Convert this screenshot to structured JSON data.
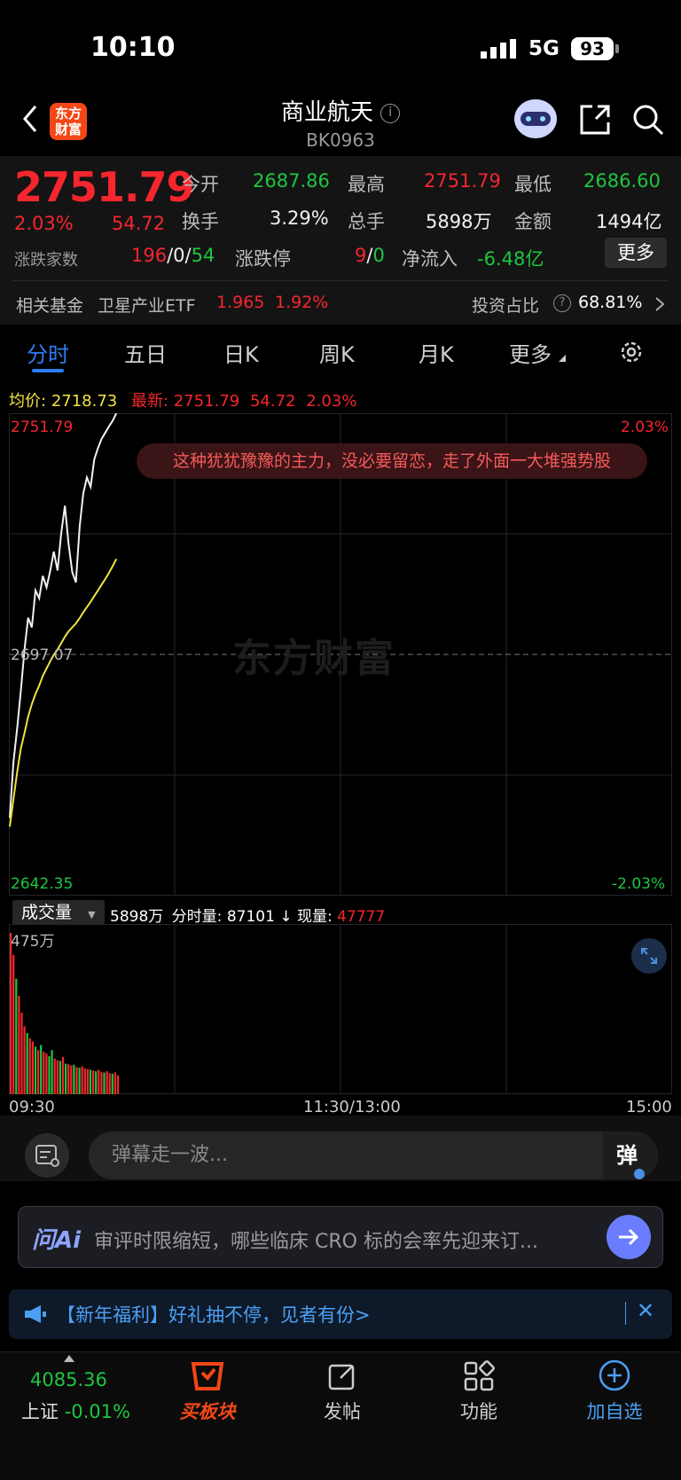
{
  "status_bar": {
    "time": "10:10",
    "network": "5G",
    "battery": "93"
  },
  "header": {
    "title": "商业航天",
    "code": "BK0963",
    "logo_text": "东方财富"
  },
  "quote": {
    "price": "2751.79",
    "change_pct": "2.03%",
    "change": "54.72",
    "open_label": "今开",
    "open": "2687.86",
    "high_label": "最高",
    "high": "2751.79",
    "low_label": "最低",
    "low": "2686.60",
    "turnover_label": "换手",
    "turnover": "3.29%",
    "volume_label": "总手",
    "volume": "5898万",
    "amount_label": "金额",
    "amount": "1494亿",
    "breadth_label": "涨跌家数",
    "breadth_up": "196",
    "breadth_flat": "0",
    "breadth_down": "54",
    "limit_label": "涨跌停",
    "limit_up": "9",
    "limit_down": "0",
    "netflow_label": "净流入",
    "netflow": "-6.48亿",
    "more_label": "更多",
    "fund_label": "相关基金",
    "fund_name": "卫星产业ETF",
    "fund_price": "1.965",
    "fund_pct": "1.92%",
    "ratio_label": "投资占比",
    "ratio": "68.81%"
  },
  "tabs": [
    "分时",
    "五日",
    "日K",
    "周K",
    "月K",
    "更多"
  ],
  "chart_info": {
    "avg_label": "均价:",
    "avg": "2718.73",
    "latest_label": "最新:",
    "latest": "2751.79",
    "latest_change": "54.72",
    "latest_pct": "2.03%",
    "top_price": "2751.79",
    "top_pct": "2.03%",
    "mid_price": "2697.07",
    "bottom_price": "2642.35",
    "bottom_pct": "-2.03%",
    "danmu": "这种犹犹豫豫的主力，没必要留恋，走了外面一大堆强势股",
    "watermark": "东方财富"
  },
  "volume_info": {
    "selector": "成交量",
    "total": "5898万",
    "minute_label": "分时量:",
    "minute_val": "87101",
    "now_label": "现量:",
    "now_val": "47777",
    "max": "475万"
  },
  "time_axis": {
    "start": "09:30",
    "mid": "11:30/13:00",
    "end": "15:00"
  },
  "chart_data": {
    "type": "line",
    "ylim": [
      2642.35,
      2751.79
    ],
    "series": [
      {
        "name": "最新",
        "values": [
          2660.0,
          2672.5,
          2680.2,
          2688.6,
          2698.1,
          2705.4,
          2703.2,
          2711.6,
          2709.8,
          2714.9,
          2712.3,
          2716.0,
          2720.4,
          2716.1,
          2724.5,
          2730.8,
          2722.2,
          2715.7,
          2713.4,
          2726.0,
          2733.6,
          2737.2,
          2735.1,
          2741.3,
          2743.9,
          2746.0,
          2747.4,
          2748.8,
          2750.1,
          2751.79
        ]
      },
      {
        "name": "均价",
        "values": [
          2658.0,
          2664.1,
          2670.3,
          2675.6,
          2679.2,
          2682.9,
          2685.8,
          2688.1,
          2690.0,
          2692.2,
          2693.9,
          2695.5,
          2697.0,
          2698.2,
          2699.6,
          2701.1,
          2702.3,
          2703.2,
          2704.1,
          2705.3,
          2706.6,
          2707.8,
          2709.0,
          2710.3,
          2711.6,
          2712.9,
          2714.2,
          2715.6,
          2717.1,
          2718.73
        ]
      }
    ],
    "volume_max": 4750000,
    "volume": [
      4750000,
      4100000,
      3400000,
      2900000,
      2400000,
      2000000,
      1800000,
      1650000,
      1550000,
      1400000,
      1300000,
      1450000,
      1250000,
      1200000,
      1120000,
      1300000,
      1050000,
      1000000,
      980000,
      1100000,
      900000,
      880000,
      850000,
      870000,
      800000,
      780000,
      820000,
      760000,
      740000,
      720000,
      700000,
      680000,
      720000,
      660000,
      640000,
      680000,
      620000,
      600000,
      640000,
      560000
    ],
    "volume_up": [
      true,
      true,
      false,
      true,
      true,
      true,
      false,
      true,
      true,
      false,
      true,
      false,
      true,
      true,
      false,
      false,
      true,
      true,
      false,
      true,
      false,
      true,
      true,
      false,
      true,
      false,
      true,
      true,
      true,
      false,
      true,
      false,
      true,
      true,
      false,
      true,
      true,
      false,
      true,
      true
    ]
  },
  "danmu_input": {
    "placeholder": "弹幕走一波...",
    "toggle": "弹"
  },
  "ai": {
    "logo": "问Ai",
    "text": "审评时限缩短，哪些临床 CRO 标的会率先迎来订..."
  },
  "promo": {
    "text": "【新年福利】好礼抽不停，见者有份>"
  },
  "bottom_nav": {
    "index_value": "4085.36",
    "index_name": "上证",
    "index_pct": "-0.01%",
    "buy_label": "买板块",
    "post_label": "发帖",
    "func_label": "功能",
    "add_label": "加自选"
  },
  "colors": {
    "up": "#f5262e",
    "down": "#1ec640",
    "accent": "#2e7cf6",
    "avg_line": "#f3e33c"
  }
}
